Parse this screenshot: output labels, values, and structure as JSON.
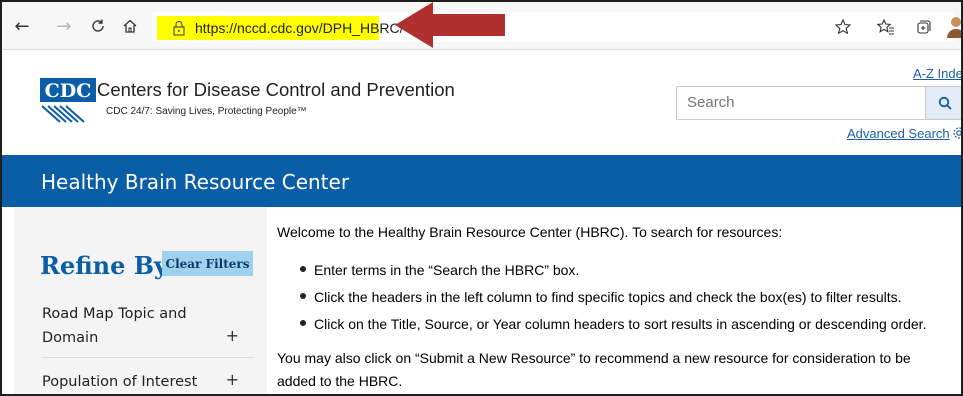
{
  "browser": {
    "url": "https://nccd.cdc.gov/DPH_HBRC/"
  },
  "header": {
    "logo_text": "CDC",
    "org_name": "Centers for Disease Control and Prevention",
    "tagline": "CDC 24/7: Saving Lives, Protecting People™",
    "az_index": "A-Z Index",
    "search_placeholder": "Search",
    "advanced_search": "Advanced Search"
  },
  "banner": {
    "title": "Healthy Brain Resource Center"
  },
  "sidebar": {
    "refine_title": "Refine By:",
    "clear_filters": "Clear Filters",
    "facets": [
      {
        "label_line1": "Road Map Topic and",
        "label_line2": "Domain",
        "toggle": "+"
      },
      {
        "label_line1": "Population of Interest",
        "toggle": "+"
      }
    ]
  },
  "main": {
    "intro": "Welcome to the Healthy Brain Resource Center (HBRC). To search for resources:",
    "bullets": [
      "Enter terms in the “Search the HBRC” box.",
      "Click the headers in the left column to find specific topics and check the box(es) to filter results.",
      "Click on the Title, Source, or Year column headers to sort results in ascending or descending order."
    ],
    "tail_line1": "You may also click on “Submit a New Resource” to recommend a new resource for consideration to be",
    "tail_line2": "added to the HBRC."
  },
  "colors": {
    "banner": "#0a5ea8",
    "link": "#1d5fa5",
    "highlight": "#ffff00",
    "arrow": "#b03030",
    "clear_button": "#9ed1ee"
  }
}
